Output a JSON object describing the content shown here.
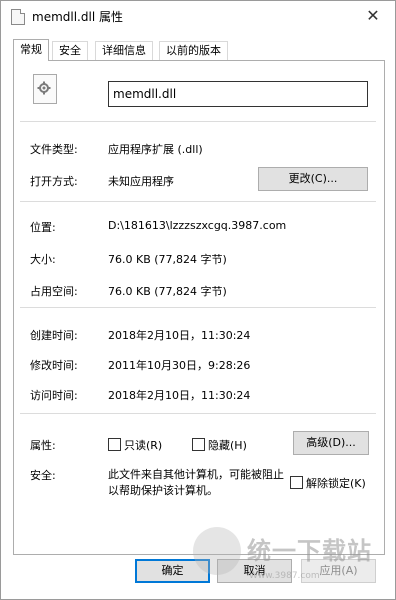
{
  "window": {
    "title": "memdll.dll 属性",
    "close_label": "✕"
  },
  "tabs": [
    {
      "label": "常规"
    },
    {
      "label": "安全"
    },
    {
      "label": "详细信息"
    },
    {
      "label": "以前的版本"
    }
  ],
  "general": {
    "file_name": "memdll.dll",
    "file_type": {
      "label": "文件类型:",
      "value": "应用程序扩展 (.dll)"
    },
    "opens_with": {
      "label": "打开方式:",
      "value": "未知应用程序",
      "button": "更改(C)..."
    },
    "location": {
      "label": "位置:",
      "value": "D:\\181613\\lzzzszxcgq.3987.com"
    },
    "size": {
      "label": "大小:",
      "value": "76.0 KB (77,824 字节)"
    },
    "size_on_disk": {
      "label": "占用空间:",
      "value": "76.0 KB (77,824 字节)"
    },
    "created": {
      "label": "创建时间:",
      "value": "2018年2月10日，11:30:24"
    },
    "modified": {
      "label": "修改时间:",
      "value": "2011年10月30日，9:28:26"
    },
    "accessed": {
      "label": "访问时间:",
      "value": "2018年2月10日，11:30:24"
    },
    "attributes": {
      "label": "属性:",
      "readonly": "只读(R)",
      "hidden": "隐藏(H)",
      "advanced_button": "高级(D)..."
    },
    "security": {
      "label": "安全:",
      "text": "此文件来自其他计算机，可能被阻止以帮助保护该计算机。",
      "unblock": "解除锁定(K)"
    }
  },
  "buttons": {
    "ok": "确定",
    "cancel": "取消",
    "apply": "应用(A)"
  },
  "watermark": {
    "text": "统一下载站",
    "sub": "Www.3987.com"
  }
}
